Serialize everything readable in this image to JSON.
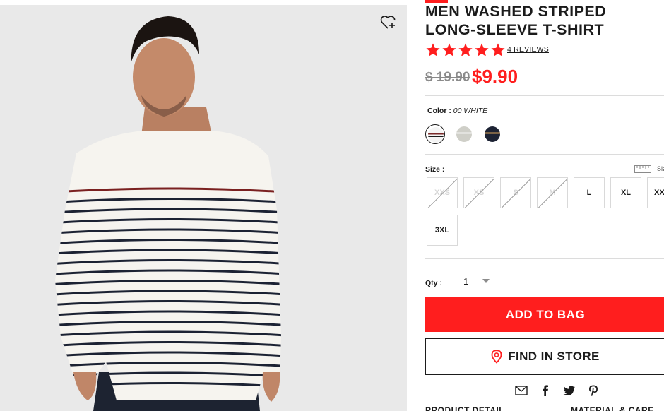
{
  "product": {
    "title": "MEN WASHED STRIPED LONG-SLEEVE T-SHIRT",
    "rating": 5,
    "rating_max": 5,
    "reviews_label": "4 REVIEWS",
    "original_price": "$ 19.90",
    "sale_price": "$9.90"
  },
  "colors": {
    "label": "Color :",
    "selected": "00 WHITE",
    "swatches": [
      {
        "name": "white",
        "base": "#f4f4f4",
        "stripe": "#7a2a2a"
      },
      {
        "name": "gray",
        "base": "#cfcfc8",
        "stripe": "#f4f4f4"
      },
      {
        "name": "navy",
        "base": "#1c2233",
        "stripe": "#d9a25a"
      }
    ]
  },
  "sizes": {
    "label": "Size :",
    "guide_label": "Size Guide",
    "options": [
      {
        "label": "XXS",
        "available": false
      },
      {
        "label": "XS",
        "available": false
      },
      {
        "label": "S",
        "available": false
      },
      {
        "label": "M",
        "available": false
      },
      {
        "label": "L",
        "available": true
      },
      {
        "label": "XL",
        "available": true
      },
      {
        "label": "XXL",
        "available": true
      },
      {
        "label": "3XL",
        "available": true
      }
    ]
  },
  "quantity": {
    "label": "Qty :",
    "value": "1"
  },
  "actions": {
    "add_to_bag": "ADD TO BAG",
    "find_in_store": "FIND IN STORE"
  },
  "share_icons": [
    "mail-icon",
    "facebook-icon",
    "twitter-icon",
    "pinterest-icon"
  ],
  "bottom": {
    "left": "PRODUCT DETAIL",
    "right": "MATERIAL & CARE"
  },
  "theme": {
    "accent": "#ff1e1e",
    "text": "#1b1b1b",
    "muted": "#8a8a8a"
  }
}
